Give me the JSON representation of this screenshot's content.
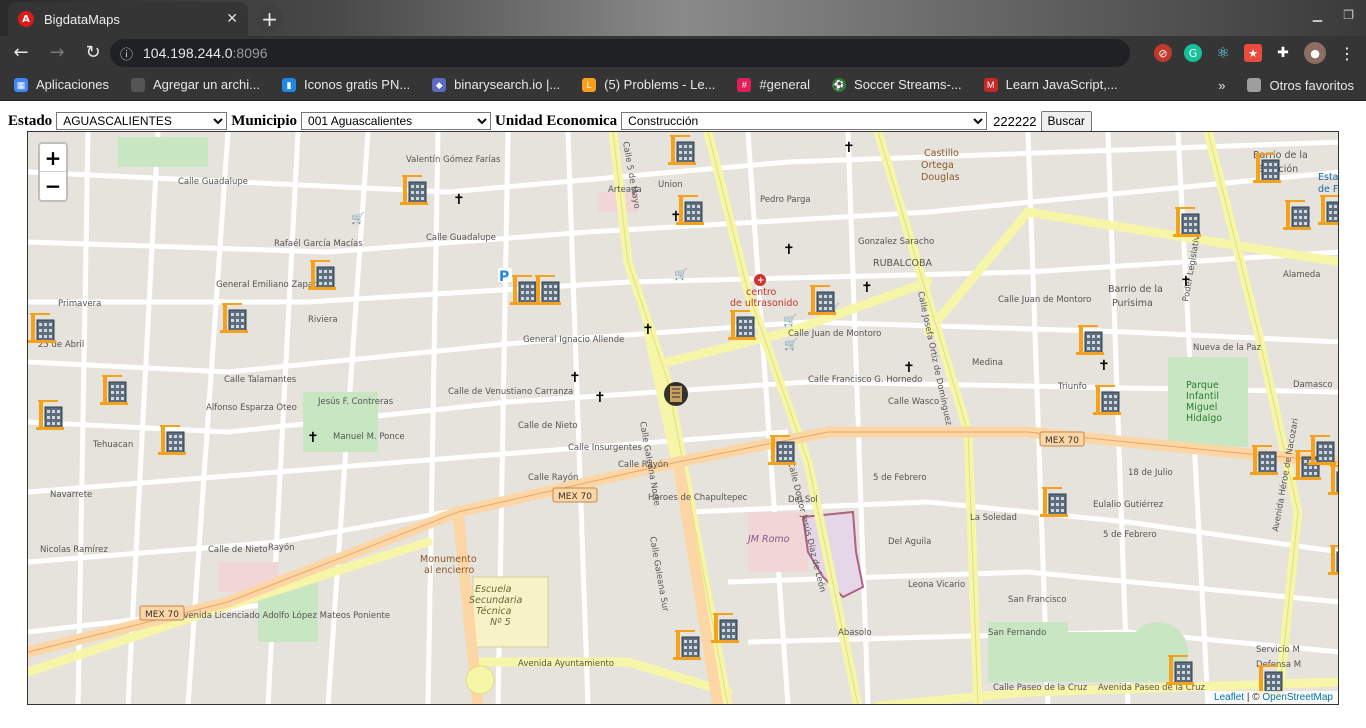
{
  "browser": {
    "tab_title": "BigdataMaps",
    "tab_favicon_letter": "A",
    "url_host": "104.198.244.0",
    "url_port": ":8096",
    "bookmarks": [
      {
        "label": "Aplicaciones",
        "icon": "apps-grid-icon",
        "color": "#4285f4"
      },
      {
        "label": "Agregar un archi...",
        "icon": "page-icon",
        "color": "#353535"
      },
      {
        "label": "Iconos gratis PN...",
        "icon": "iconos-icon",
        "color": "#1e88e5"
      },
      {
        "label": "binarysearch.io |...",
        "icon": "binarysearch-icon",
        "color": "#5c6bc0"
      },
      {
        "label": "(5) Problems - Le...",
        "icon": "leetcode-icon",
        "color": "#f89f1b"
      },
      {
        "label": "#general",
        "icon": "slack-icon",
        "color": "#e01e5a"
      },
      {
        "label": "Soccer Streams-...",
        "icon": "soccer-icon",
        "color": "#2e7d32"
      },
      {
        "label": "Learn JavaScript,...",
        "icon": "learn-js-icon",
        "color": "#c62828"
      }
    ],
    "more_bookmarks": "»",
    "other_bookmarks": "Otros favoritos"
  },
  "filters": {
    "estado_label": "Estado",
    "estado_value": "AGUASCALIENTES",
    "municipio_label": "Municipio",
    "municipio_value": "001 Aguascalientes",
    "unidad_label": "Unidad Economica",
    "unidad_value": "Construcción",
    "code": "222222",
    "search_button": "Buscar"
  },
  "map": {
    "zoom_in": "+",
    "zoom_out": "−",
    "attribution_leaflet": "Leaflet",
    "attribution_sep": " | © ",
    "attribution_osm": "OpenStreetMap",
    "places": {
      "castillo": "Castillo Ortega Douglas",
      "rubalcoba": "RUBALCOBA",
      "centro_ultrasonido": "centro de ultrasonido",
      "barrio_purisima": "Barrio de la Purisima",
      "parque": "Parque Infantil Miguel Hidalgo",
      "jm_romo": "JM Romo",
      "monumento": "Monumento al encierro",
      "escuela": "Escuela Secundaria Técnica Nº 5",
      "barrio_estacion": "Barrio de la Estación",
      "esta_ferr": "Esta de Ferr"
    },
    "roads": {
      "mex70_1": "MEX 70",
      "mex70_2": "MEX 70",
      "mex70_3": "MEX 70",
      "streets": [
        "Calle Guadalupe",
        "Valentín Gómez Farías",
        "Rafaél García Macías",
        "General Emiliano Zapata",
        "Calle Talamantes",
        "Alfonso Esparza Oteo",
        "Jesús F. Contreras",
        "Manuel M. Ponce",
        "Calle de Venustiano Carranza",
        "General Ignacio Allende",
        "Calle Juan de Montoro",
        "Calle Francisco G. Hornedo",
        "Calle Wasco",
        "Medina",
        "Triunfo",
        "Calle Juan de Montoro",
        "Alameda",
        "Nueva de la Paz",
        "Damasco",
        "Calle de Nieto",
        "Calle Insurgentes",
        "Calle Rayón",
        "Heroes de Chapultepec",
        "Del Sol",
        "5 de Febrero",
        "Del Aguila",
        "Leona Vicario",
        "San Francisco",
        "San Fernando",
        "Abasolo",
        "Calle Paseo de la Cruz",
        "Avenida Ayuntamiento",
        "Avenida Licenciado Adolfo López Mateos Poniente",
        "Calle Galeana Norte",
        "Calle Galeana Sur",
        "Calle Doctor Jesús Díaz de León",
        "Calle Josefa Ortiz de Domínguez",
        "Avenida Héroe de Nacozari",
        "Calle 5 de Mayo",
        "Arteaga",
        "Pedro Parga",
        "Gonzalez Saracho",
        "La Soledad",
        "5 de Febrero",
        "18 de Julio",
        "Eulalio Gutiérrez",
        "Calle de Nieto",
        "Rayón",
        "Nicolas Ramírez",
        "Primavera",
        "25 de Abril",
        "Tehuacan",
        "Navarrete",
        "Riviera",
        "Union",
        "Medina",
        "Poder Legislativo"
      ]
    }
  }
}
